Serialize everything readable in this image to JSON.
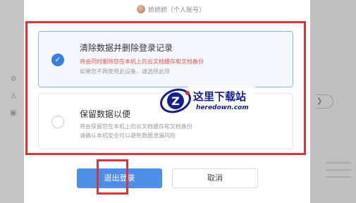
{
  "account": {
    "name": "娇娇娇（个人账号）"
  },
  "options": [
    {
      "title": "清除数据并删除登录记录",
      "line1": "将会同时删除您在本机上的云文档缓存和文档备份",
      "line2": "如果您不再使用此设备，请选择此项",
      "selected": true
    },
    {
      "title": "保留数据以便",
      "line1": "将会保留您在本机上的云文档缓存和文档备份",
      "line2": "请确认本机安全可以避免数据泄漏风险",
      "selected": false
    }
  ],
  "buttons": {
    "logout": "退出登录",
    "cancel": "取消"
  },
  "watermark": {
    "title": "这里下载站",
    "url": "heredown.com"
  },
  "colors": {
    "accent": "#3b7de3",
    "warning_text": "#e0524b",
    "highlight_frame": "#d4373c"
  }
}
